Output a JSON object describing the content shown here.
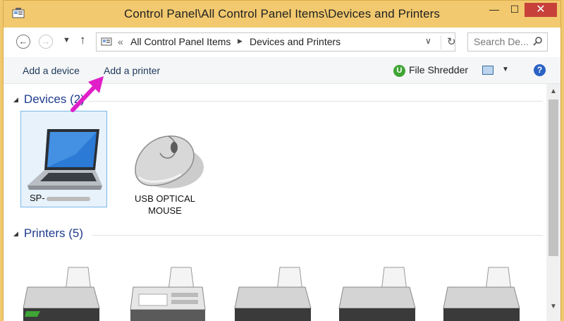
{
  "window": {
    "title": "Control Panel\\All Control Panel Items\\Devices and Printers",
    "minimize_glyph": "—",
    "maximize_glyph": "☐",
    "close_glyph": "✕"
  },
  "address": {
    "back_glyph": "←",
    "forward_glyph": "→",
    "dropdown_glyph": "▼",
    "up_glyph": "↑",
    "chevrons": "«",
    "crumbs": [
      "All Control Panel Items",
      "Devices and Printers"
    ],
    "separator_glyph": "▶",
    "addr_dropdown_glyph": "∨",
    "refresh_glyph": "↻"
  },
  "search": {
    "placeholder": "Search De...",
    "icon": "search-icon"
  },
  "toolbar": {
    "add_device": "Add a device",
    "add_printer": "Add a printer",
    "file_shredder": "File Shredder",
    "shredder_icon_letter": "U",
    "view_dropdown_glyph": "▼",
    "help_glyph": "?"
  },
  "groups": {
    "devices": {
      "label": "Devices (2)",
      "triangle": "◢"
    },
    "printers": {
      "label": "Printers (5)",
      "triangle": "◢"
    }
  },
  "devices": [
    {
      "label": "SP-",
      "icon": "laptop-icon",
      "selected": true
    },
    {
      "label": "USB OPTICAL MOUSE",
      "icon": "mouse-icon",
      "selected": false
    }
  ],
  "printers": [
    {
      "icon": "printer-icon"
    },
    {
      "icon": "fax-icon"
    },
    {
      "icon": "printer-icon"
    },
    {
      "icon": "printer-icon"
    },
    {
      "icon": "printer-icon"
    }
  ],
  "colors": {
    "titlebar": "#f2c96e",
    "close_button": "#c7413a",
    "group_heading": "#1e3c8c",
    "annotation_arrow": "#e01fc8",
    "selection": "#e7f2fb"
  },
  "scrollbar": {
    "up_glyph": "▲",
    "down_glyph": "▼"
  }
}
